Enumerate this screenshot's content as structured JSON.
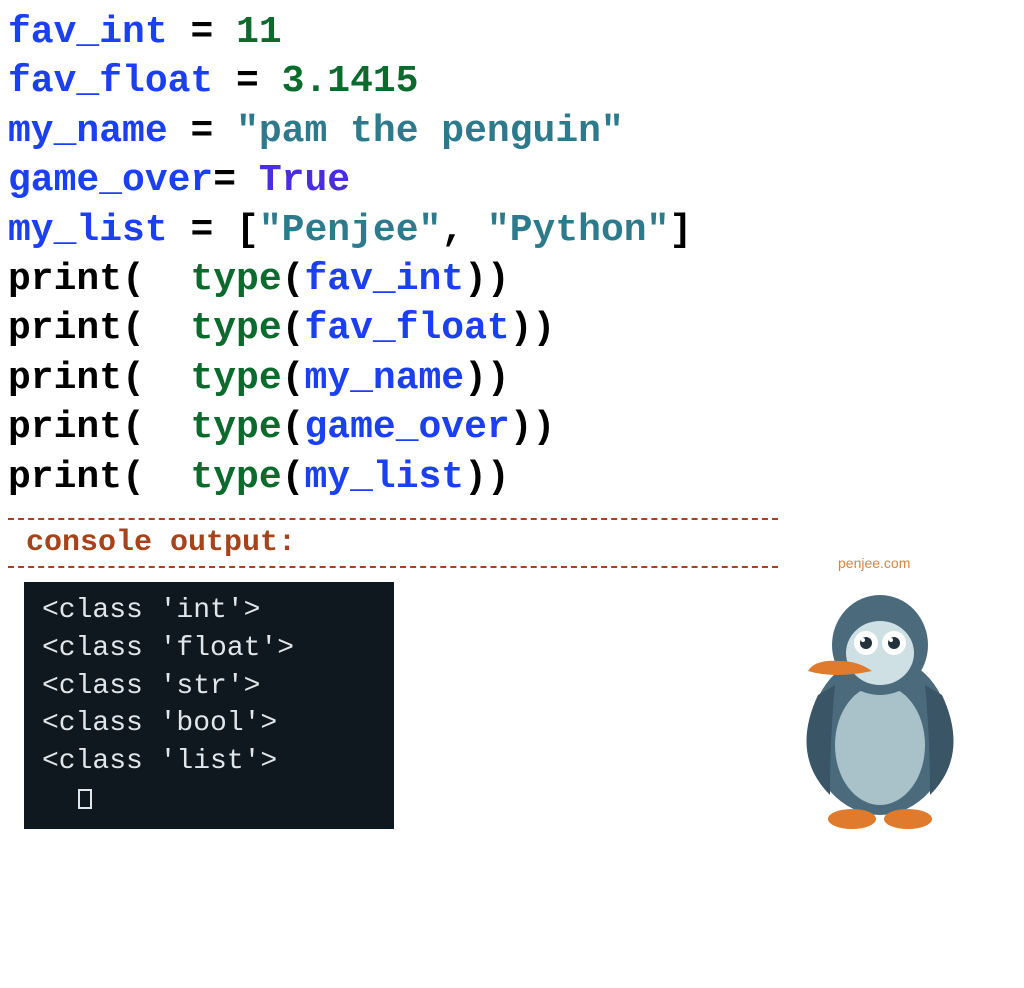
{
  "code": {
    "l1_var": "fav_int",
    "l1_op": " = ",
    "l1_val": "11",
    "l2_var": "fav_float",
    "l2_op": " = ",
    "l2_val": "3.1415",
    "l3_var": "my_name",
    "l3_op": " = ",
    "l3_val": "\"pam the penguin\"",
    "l4_var": "game_over",
    "l4_op": "= ",
    "l4_val": "True",
    "l5_var": "my_list",
    "l5_op": " = ",
    "l5_lb": "[",
    "l5_s1": "\"Penjee\"",
    "l5_comma": ", ",
    "l5_s2": "\"Python\"",
    "l5_rb": "]",
    "print_fn": "print",
    "type_fn": "type",
    "open_outer": "(  ",
    "open_inner": "(",
    "close_both": "))",
    "arg1": "fav_int",
    "arg2": "fav_float",
    "arg3": "my_name",
    "arg4": "game_over",
    "arg5": "my_list"
  },
  "console": {
    "label": "console output:",
    "lines": [
      "<class 'int'>",
      "<class 'float'>",
      "<class 'str'>",
      "<class 'bool'>",
      "<class 'list'>"
    ]
  },
  "branding": {
    "site": "penjee.com"
  }
}
